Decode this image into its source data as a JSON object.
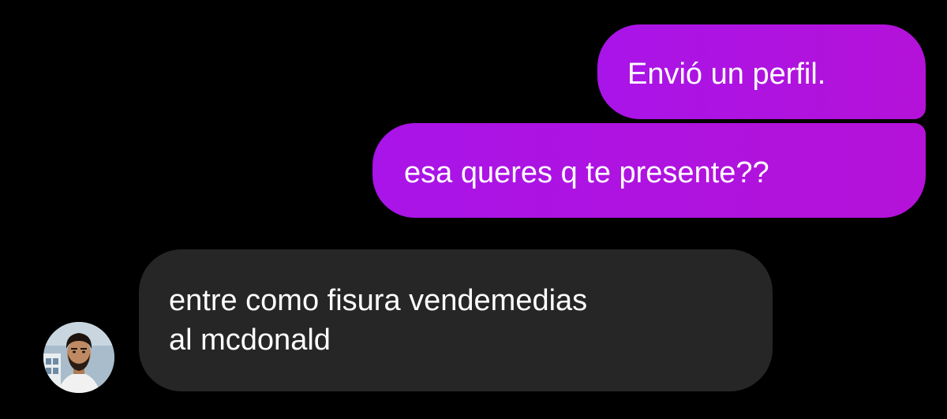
{
  "conversation": {
    "messages": [
      {
        "sender": "me",
        "text": "Envió un perfil."
      },
      {
        "sender": "me",
        "text": "esa queres q te presente??"
      },
      {
        "sender": "other",
        "lines": [
          "entre como fisura vendemedias",
          "al mcdonald"
        ]
      }
    ],
    "contact": {
      "avatar_icon": "user-avatar-photo"
    }
  },
  "colors": {
    "background": "#000000",
    "outgoing_bubble": "#b010dd",
    "incoming_bubble": "#262626",
    "text": "#ffffff"
  }
}
